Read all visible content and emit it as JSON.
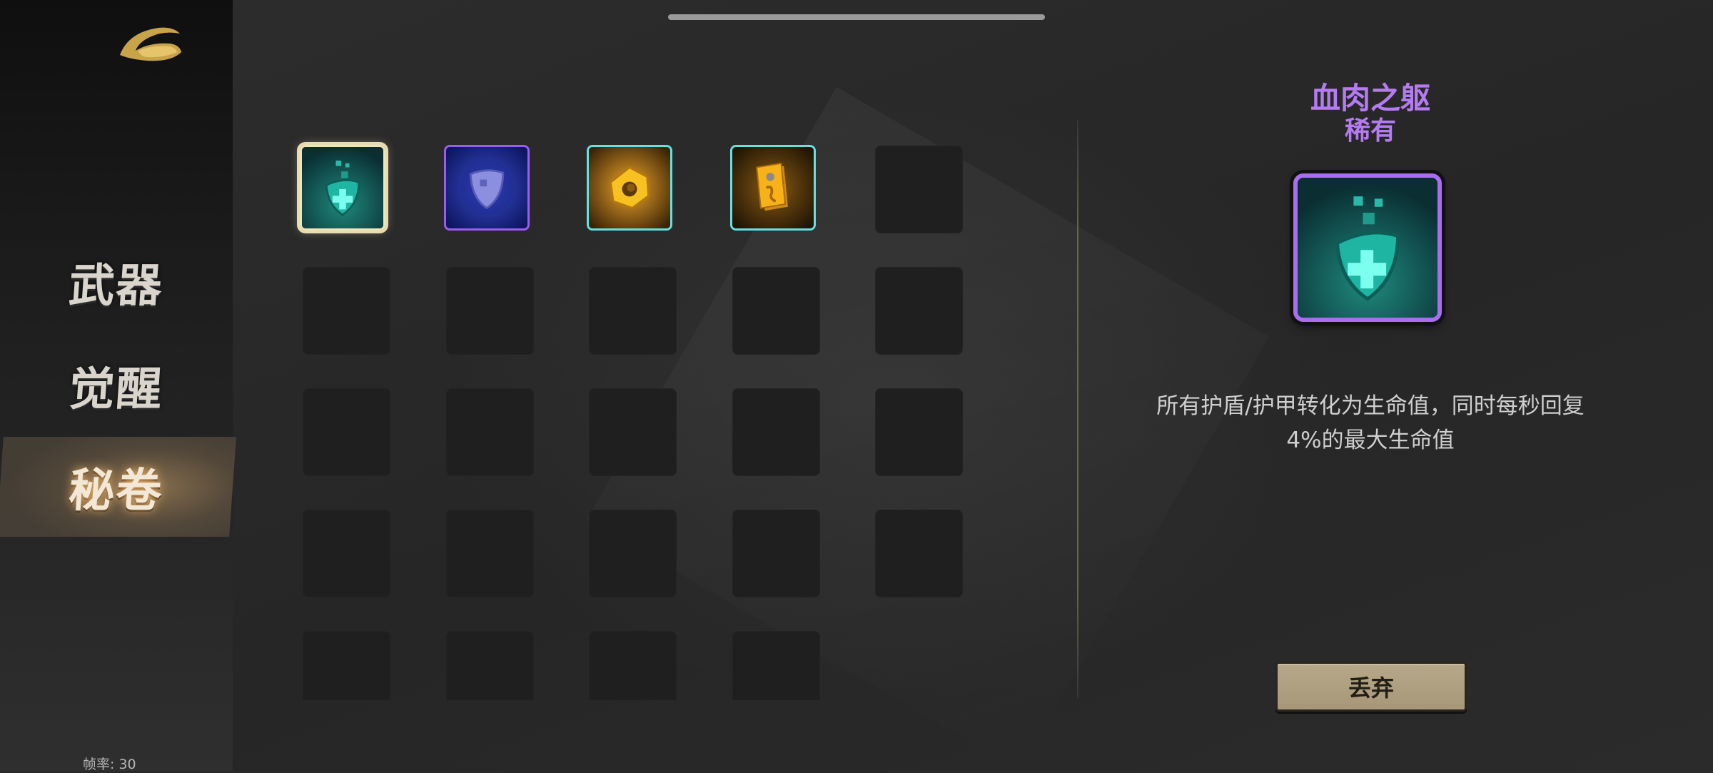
{
  "sidebar": {
    "logo_icon": "golden-wing-emblem-icon",
    "tabs": [
      {
        "label": "武器",
        "active": false
      },
      {
        "label": "觉醒",
        "active": false
      },
      {
        "label": "秘卷",
        "active": true
      }
    ],
    "fps_text": "帧率: 30"
  },
  "inventory": {
    "rows": 5,
    "columns": 5,
    "items": [
      {
        "icon": "teal-shield-cross-icon",
        "border": "#f0e4b8",
        "selected": true
      },
      {
        "icon": "blue-purple-shield-icon",
        "border": "#9b5cf0",
        "selected": false
      },
      {
        "icon": "golden-ring-icon",
        "border": "#66e0e0",
        "selected": false
      },
      {
        "icon": "golden-scroll-icon",
        "border": "#66e0e0",
        "selected": false
      }
    ]
  },
  "detail": {
    "name": "血肉之躯",
    "rarity": "稀有",
    "rarity_color": "#b57cf2",
    "icon": "teal-shield-cross-icon",
    "description": "所有护盾/护甲转化为生命值，同时每秒回复4%的最大生命值",
    "discard_label": "丢弃"
  }
}
